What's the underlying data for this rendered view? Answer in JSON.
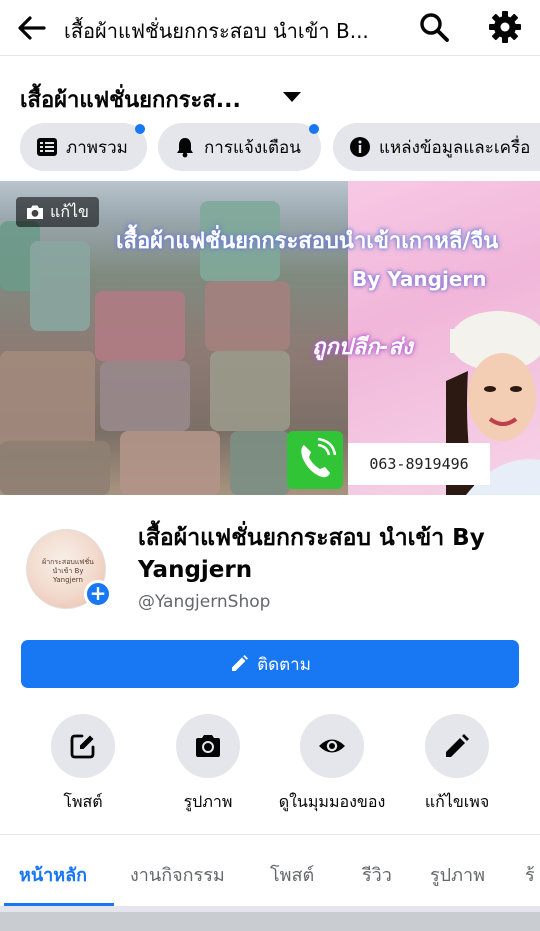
{
  "topbar": {
    "title": "เสื้อผ้าแฟชั่นยกกระสอบ นำเข้า B..."
  },
  "page_header": {
    "name": "เสื้อผ้าแฟชั่นยกกระส..."
  },
  "chips": [
    {
      "label": "ภาพรวม",
      "icon": "overview-list-icon",
      "has_dot": true
    },
    {
      "label": "การแจ้งเตือน",
      "icon": "bell-icon",
      "has_dot": true
    },
    {
      "label": "แหล่งข้อมูลและเครื่อ",
      "icon": "info-icon",
      "has_dot": false
    }
  ],
  "cover": {
    "edit_label": "แก้ไข",
    "banner_text": "เสื้อผ้าแฟชั่นยกกระสอบนำเข้าเกาหลี/จีน",
    "by_text": "By Yangjern",
    "sub_text": "ถูกปลีก-ส่ง",
    "phone": "063-8919496"
  },
  "profile": {
    "avatar_text": "ผ้ากระสอบแฟชั่น นำเข้า By Yangjern",
    "title": "เสื้อผ้าแฟชั่นยกกระสอบ นำเข้า By Yangjern",
    "handle": "@YangjernShop"
  },
  "follow_button": {
    "label": "ติดตาม"
  },
  "actions": [
    {
      "label": "โพสต์",
      "icon": "compose-icon"
    },
    {
      "label": "รูปภาพ",
      "icon": "camera-icon"
    },
    {
      "label": "ดูในมุมมองของ",
      "icon": "eye-icon"
    },
    {
      "label": "แก้ไขเพจ",
      "icon": "pencil-icon"
    }
  ],
  "tabs": [
    "หน้าหลัก",
    "งานกิจกรรม",
    "โพสต์",
    "รีวิว",
    "รูปภาพ",
    "ร้"
  ],
  "colors": {
    "accent": "#1877f2",
    "chip_bg": "#e4e6eb"
  }
}
